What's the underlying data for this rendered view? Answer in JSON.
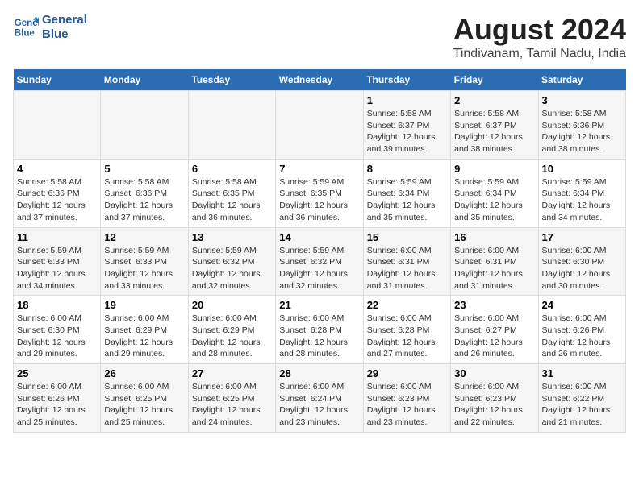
{
  "header": {
    "logo_line1": "General",
    "logo_line2": "Blue",
    "title": "August 2024",
    "subtitle": "Tindivanam, Tamil Nadu, India"
  },
  "weekdays": [
    "Sunday",
    "Monday",
    "Tuesday",
    "Wednesday",
    "Thursday",
    "Friday",
    "Saturday"
  ],
  "weeks": [
    [
      {
        "day": "",
        "info": ""
      },
      {
        "day": "",
        "info": ""
      },
      {
        "day": "",
        "info": ""
      },
      {
        "day": "",
        "info": ""
      },
      {
        "day": "1",
        "info": "Sunrise: 5:58 AM\nSunset: 6:37 PM\nDaylight: 12 hours\nand 39 minutes."
      },
      {
        "day": "2",
        "info": "Sunrise: 5:58 AM\nSunset: 6:37 PM\nDaylight: 12 hours\nand 38 minutes."
      },
      {
        "day": "3",
        "info": "Sunrise: 5:58 AM\nSunset: 6:36 PM\nDaylight: 12 hours\nand 38 minutes."
      }
    ],
    [
      {
        "day": "4",
        "info": "Sunrise: 5:58 AM\nSunset: 6:36 PM\nDaylight: 12 hours\nand 37 minutes."
      },
      {
        "day": "5",
        "info": "Sunrise: 5:58 AM\nSunset: 6:36 PM\nDaylight: 12 hours\nand 37 minutes."
      },
      {
        "day": "6",
        "info": "Sunrise: 5:58 AM\nSunset: 6:35 PM\nDaylight: 12 hours\nand 36 minutes."
      },
      {
        "day": "7",
        "info": "Sunrise: 5:59 AM\nSunset: 6:35 PM\nDaylight: 12 hours\nand 36 minutes."
      },
      {
        "day": "8",
        "info": "Sunrise: 5:59 AM\nSunset: 6:34 PM\nDaylight: 12 hours\nand 35 minutes."
      },
      {
        "day": "9",
        "info": "Sunrise: 5:59 AM\nSunset: 6:34 PM\nDaylight: 12 hours\nand 35 minutes."
      },
      {
        "day": "10",
        "info": "Sunrise: 5:59 AM\nSunset: 6:34 PM\nDaylight: 12 hours\nand 34 minutes."
      }
    ],
    [
      {
        "day": "11",
        "info": "Sunrise: 5:59 AM\nSunset: 6:33 PM\nDaylight: 12 hours\nand 34 minutes."
      },
      {
        "day": "12",
        "info": "Sunrise: 5:59 AM\nSunset: 6:33 PM\nDaylight: 12 hours\nand 33 minutes."
      },
      {
        "day": "13",
        "info": "Sunrise: 5:59 AM\nSunset: 6:32 PM\nDaylight: 12 hours\nand 32 minutes."
      },
      {
        "day": "14",
        "info": "Sunrise: 5:59 AM\nSunset: 6:32 PM\nDaylight: 12 hours\nand 32 minutes."
      },
      {
        "day": "15",
        "info": "Sunrise: 6:00 AM\nSunset: 6:31 PM\nDaylight: 12 hours\nand 31 minutes."
      },
      {
        "day": "16",
        "info": "Sunrise: 6:00 AM\nSunset: 6:31 PM\nDaylight: 12 hours\nand 31 minutes."
      },
      {
        "day": "17",
        "info": "Sunrise: 6:00 AM\nSunset: 6:30 PM\nDaylight: 12 hours\nand 30 minutes."
      }
    ],
    [
      {
        "day": "18",
        "info": "Sunrise: 6:00 AM\nSunset: 6:30 PM\nDaylight: 12 hours\nand 29 minutes."
      },
      {
        "day": "19",
        "info": "Sunrise: 6:00 AM\nSunset: 6:29 PM\nDaylight: 12 hours\nand 29 minutes."
      },
      {
        "day": "20",
        "info": "Sunrise: 6:00 AM\nSunset: 6:29 PM\nDaylight: 12 hours\nand 28 minutes."
      },
      {
        "day": "21",
        "info": "Sunrise: 6:00 AM\nSunset: 6:28 PM\nDaylight: 12 hours\nand 28 minutes."
      },
      {
        "day": "22",
        "info": "Sunrise: 6:00 AM\nSunset: 6:28 PM\nDaylight: 12 hours\nand 27 minutes."
      },
      {
        "day": "23",
        "info": "Sunrise: 6:00 AM\nSunset: 6:27 PM\nDaylight: 12 hours\nand 26 minutes."
      },
      {
        "day": "24",
        "info": "Sunrise: 6:00 AM\nSunset: 6:26 PM\nDaylight: 12 hours\nand 26 minutes."
      }
    ],
    [
      {
        "day": "25",
        "info": "Sunrise: 6:00 AM\nSunset: 6:26 PM\nDaylight: 12 hours\nand 25 minutes."
      },
      {
        "day": "26",
        "info": "Sunrise: 6:00 AM\nSunset: 6:25 PM\nDaylight: 12 hours\nand 25 minutes."
      },
      {
        "day": "27",
        "info": "Sunrise: 6:00 AM\nSunset: 6:25 PM\nDaylight: 12 hours\nand 24 minutes."
      },
      {
        "day": "28",
        "info": "Sunrise: 6:00 AM\nSunset: 6:24 PM\nDaylight: 12 hours\nand 23 minutes."
      },
      {
        "day": "29",
        "info": "Sunrise: 6:00 AM\nSunset: 6:23 PM\nDaylight: 12 hours\nand 23 minutes."
      },
      {
        "day": "30",
        "info": "Sunrise: 6:00 AM\nSunset: 6:23 PM\nDaylight: 12 hours\nand 22 minutes."
      },
      {
        "day": "31",
        "info": "Sunrise: 6:00 AM\nSunset: 6:22 PM\nDaylight: 12 hours\nand 21 minutes."
      }
    ]
  ]
}
